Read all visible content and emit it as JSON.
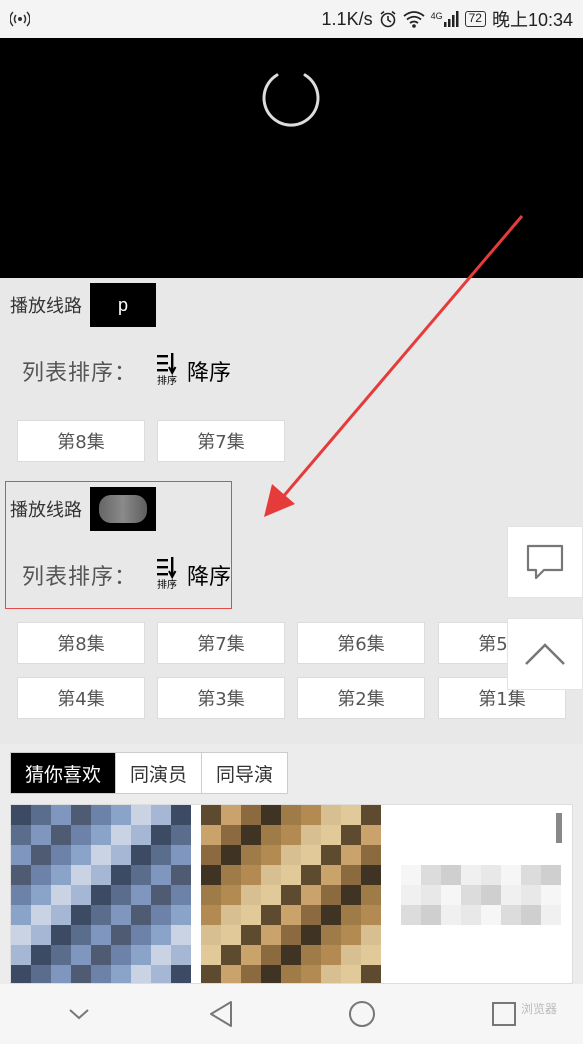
{
  "status_bar": {
    "net_speed": "1.1K/s",
    "signal_label": "4G",
    "battery": "72",
    "time": "晚上10:34"
  },
  "player": {
    "state": "loading"
  },
  "section1": {
    "route_label": "播放线路",
    "route_chip": "p",
    "sort_label": "列表排序：",
    "sort_icon_text": "排序",
    "sort_value": "降序",
    "episodes": [
      "第8集",
      "第7集"
    ]
  },
  "section2": {
    "route_label": "播放线路",
    "sort_label": "列表排序：",
    "sort_icon_text": "排序",
    "sort_value": "降序",
    "episodes": [
      "第8集",
      "第7集",
      "第6集",
      "第5集",
      "第4集",
      "第3集",
      "第2集",
      "第1集"
    ]
  },
  "recommend": {
    "tabs": [
      "猜你喜欢",
      "同演员",
      "同导演"
    ],
    "active_tab": 0
  },
  "watermark": "浏览器",
  "colors": {
    "highlight": "#e34b4b",
    "arrow": "#e53b3b",
    "active_tab": "#000000"
  }
}
